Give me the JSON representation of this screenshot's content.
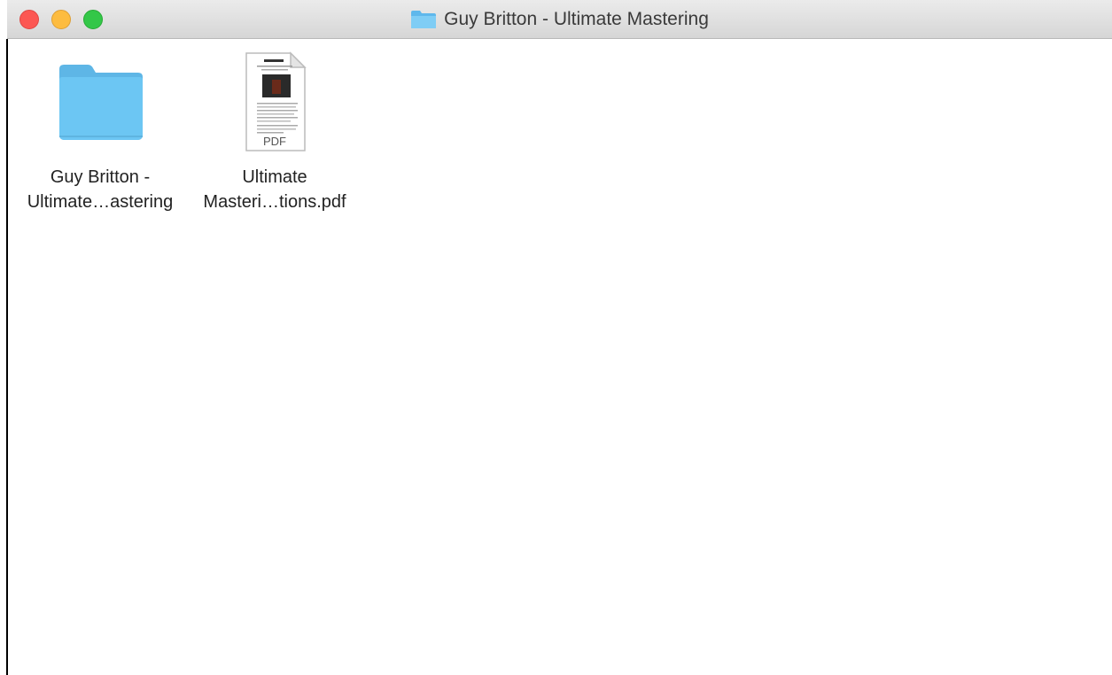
{
  "window": {
    "title": "Guy Britton - Ultimate Mastering",
    "title_icon": "folder-icon"
  },
  "items": [
    {
      "type": "folder",
      "icon": "folder-icon",
      "label_line1": "Guy Britton -",
      "label_line2": "Ultimate…astering"
    },
    {
      "type": "pdf",
      "icon": "pdf-document-icon",
      "badge": "PDF",
      "label_line1": "Ultimate",
      "label_line2": "Masteri…tions.pdf"
    }
  ],
  "colors": {
    "folder": "#6cc6f3",
    "close": "#fc5753",
    "minimize": "#fdbc40",
    "zoom": "#33c748"
  }
}
